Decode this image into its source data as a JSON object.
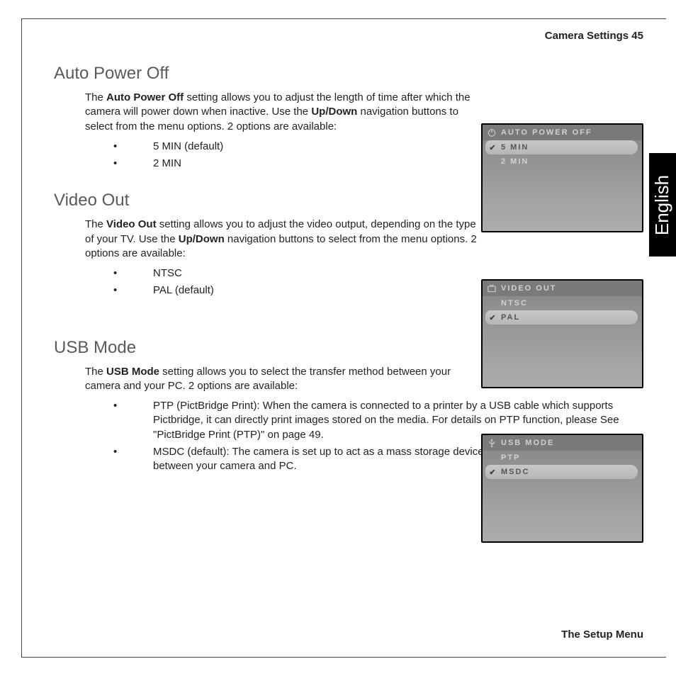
{
  "header": {
    "section": "Camera Settings",
    "page_num": "45",
    "combined": "Camera Settings  45"
  },
  "footer": {
    "label": "The Setup Menu"
  },
  "language_tab": "English",
  "sections": {
    "apo": {
      "title": "Auto Power Off",
      "para_parts": {
        "p1": "The ",
        "b1": "Auto Power Off",
        "p2": " setting allows you to adjust the length of time after which the camera will power down when inactive. Use the ",
        "b2": "Up/Down",
        "p3": " navigation buttons to select from the menu options. 2 options are available:"
      },
      "bullets": [
        "5 MIN (default)",
        "2 MIN"
      ]
    },
    "vout": {
      "title": "Video Out",
      "para_parts": {
        "p1": "The ",
        "b1": "Video Out",
        "p2": " setting allows you to adjust the video output, depending on the type of your TV. Use the ",
        "b2": "Up/Down",
        "p3": " navigation buttons to select from the menu options. 2 options are available:"
      },
      "bullets": [
        "NTSC",
        "PAL (default)"
      ]
    },
    "usb": {
      "title": "USB Mode",
      "para_parts": {
        "p1": "The ",
        "b1": "USB Mode",
        "p2": " setting allows you to select the transfer method between your camera and your PC. 2 options are available:"
      },
      "bullets": {
        "ptp_term": "PTP (PictBridge Print): ",
        "ptp_body": "When the camera is connected to a printer by a USB cable which supports Pictbridge, it can directly print images stored on the media. For details on PTP function, please See \"PictBridge Print (PTP)\" on page 49.",
        "msdc_term": "MSDC (default): ",
        "msdc_body": "The camera is set up to act as a mass storage device, allowing only for transfer of files between your camera and PC."
      }
    }
  },
  "screens": {
    "apo": {
      "title": "AUTO POWER OFF",
      "icon": "power-icon",
      "items": [
        "5 MIN",
        "2 MIN"
      ],
      "selected_index": 0
    },
    "vout": {
      "title": "VIDEO OUT",
      "icon": "tv-icon",
      "items": [
        "NTSC",
        "PAL"
      ],
      "selected_index": 1
    },
    "usb": {
      "title": "USB MODE",
      "icon": "usb-icon",
      "items": [
        "PTP",
        "MSDC"
      ],
      "selected_index": 1
    }
  }
}
